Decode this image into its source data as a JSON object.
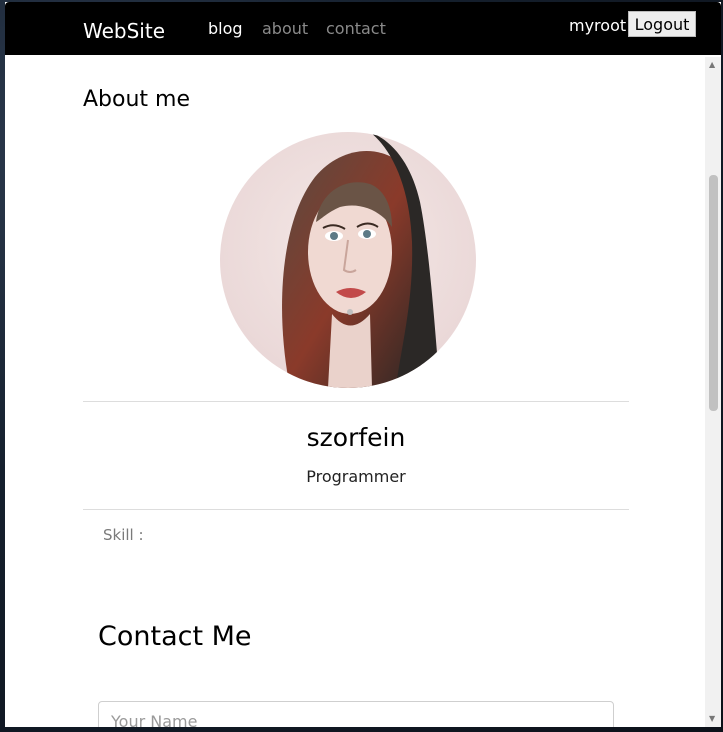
{
  "navbar": {
    "brand": "WebSite",
    "links": [
      {
        "label": "blog",
        "active": true
      },
      {
        "label": "about",
        "active": false
      },
      {
        "label": "contact",
        "active": false
      }
    ],
    "user": "myroot",
    "logout_label": "Logout"
  },
  "about": {
    "title": "About me",
    "avatar_icon": "avatar-portrait",
    "name": "szorfein",
    "role": "Programmer",
    "skill_label": "Skill :"
  },
  "contact": {
    "title": "Contact Me",
    "name_placeholder": "Your Name",
    "name_value": ""
  },
  "colors": {
    "navbar_bg": "#000000",
    "nav_inactive": "#8a8a8a",
    "page_bg": "#ffffff",
    "divider": "#dddddd"
  }
}
